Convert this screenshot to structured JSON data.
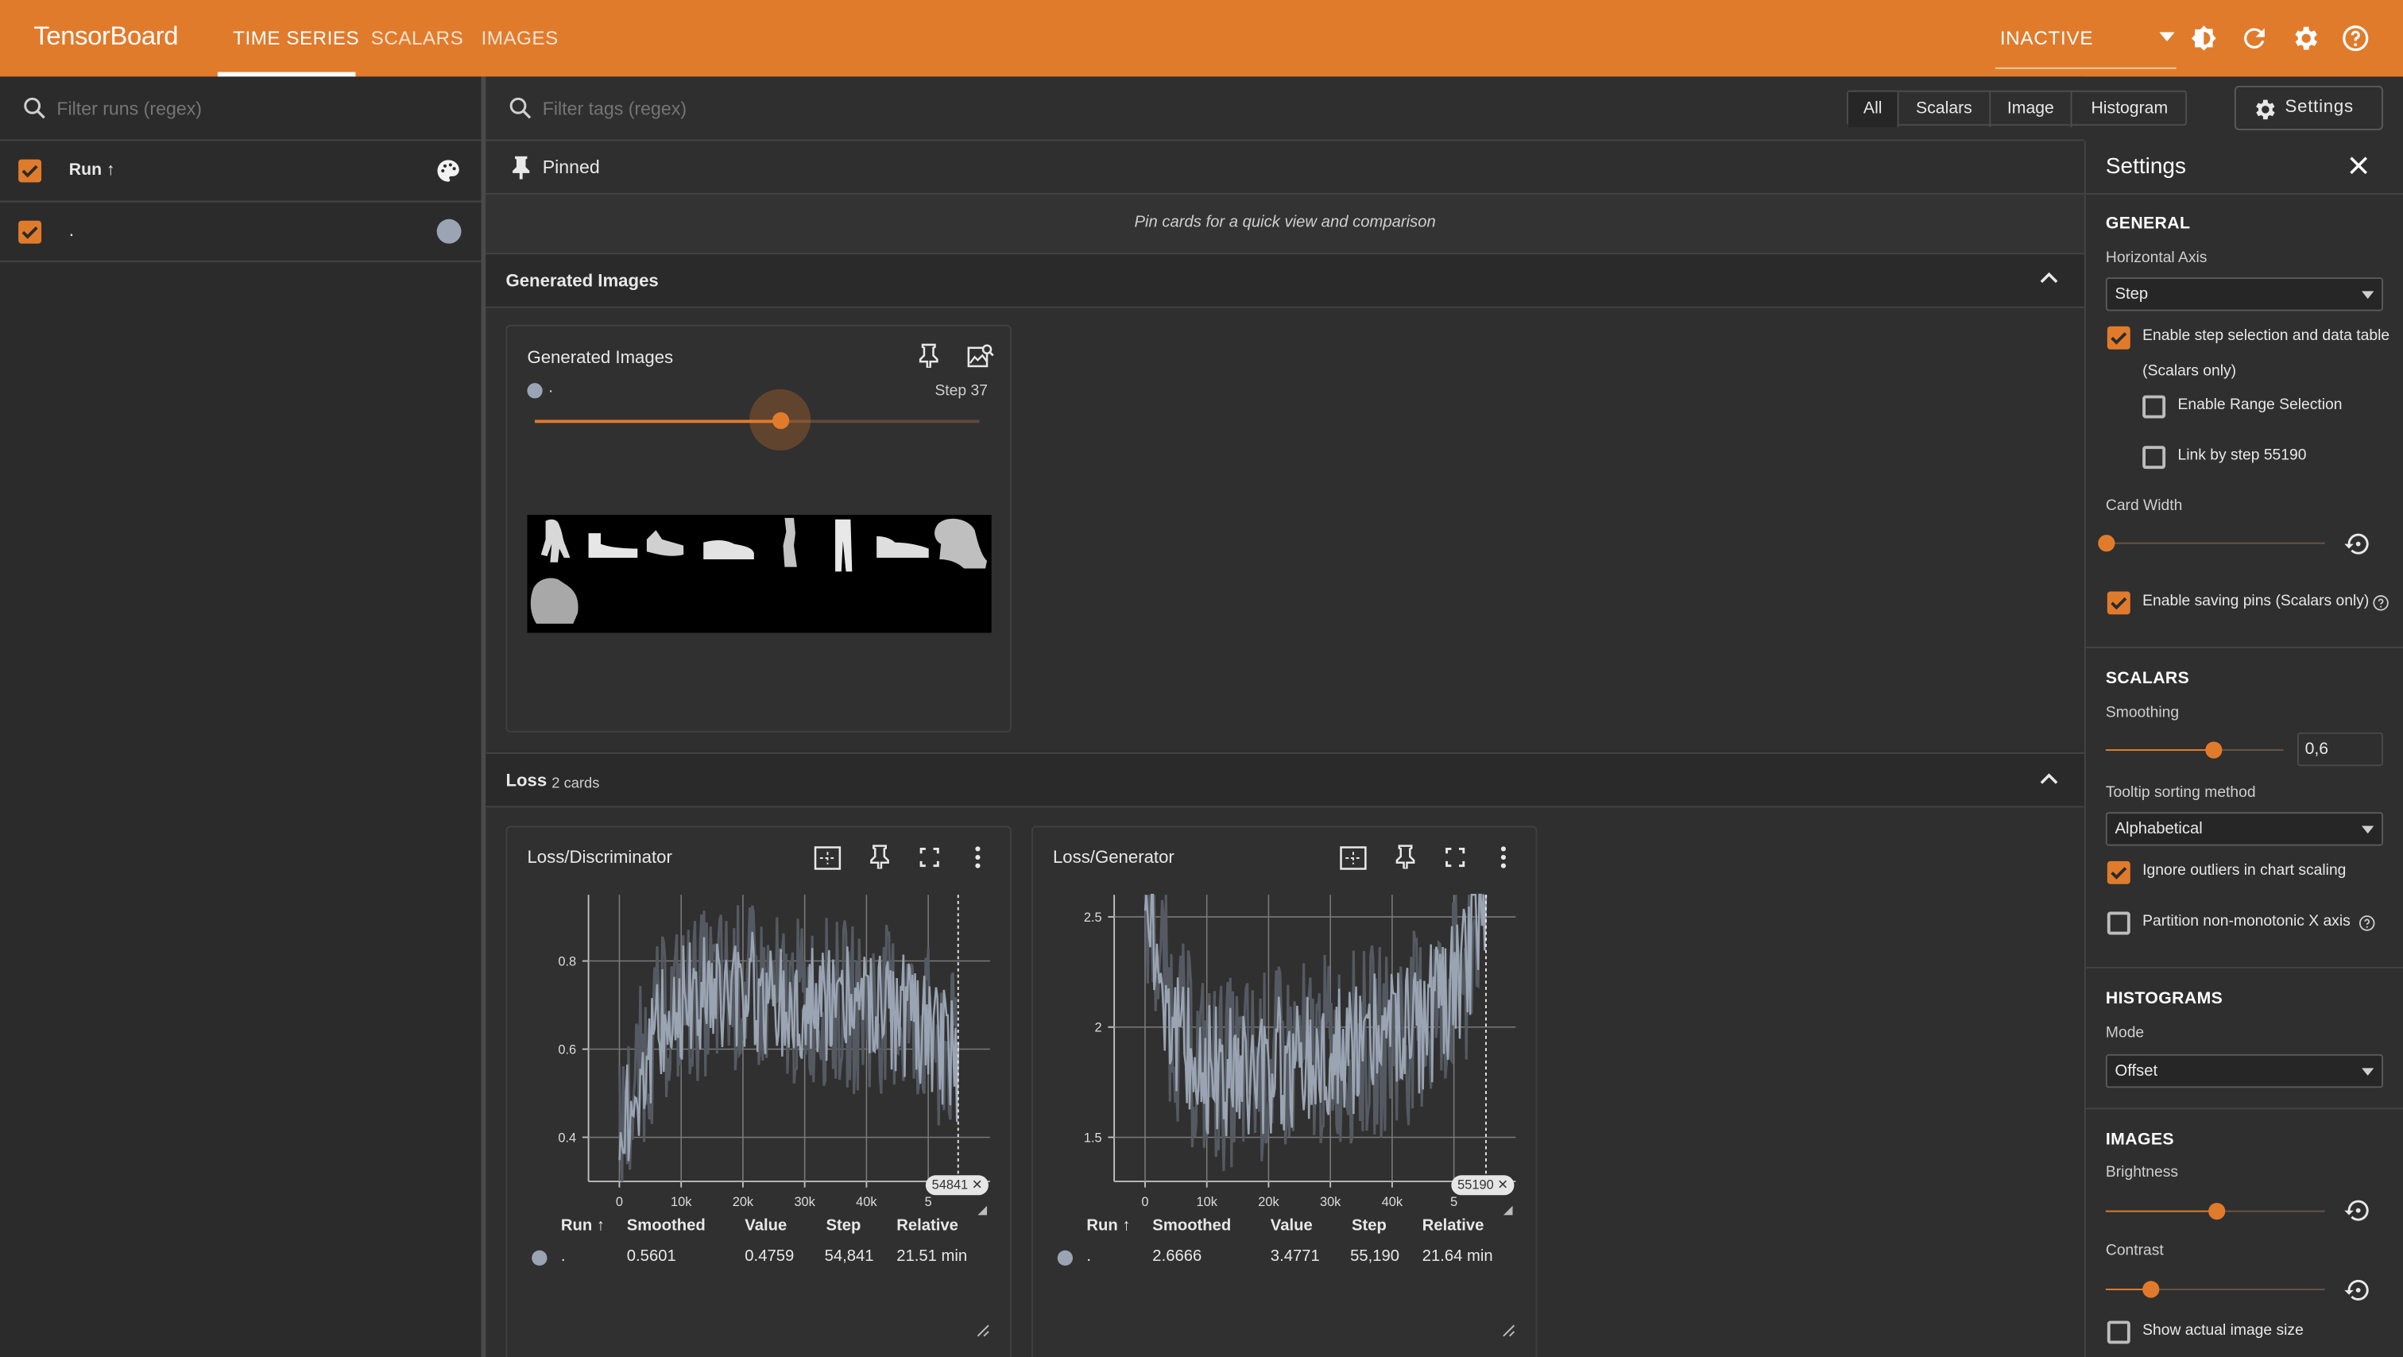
{
  "app": {
    "title": "TensorBoard"
  },
  "nav": {
    "tabs": [
      {
        "label": "TIME SERIES"
      },
      {
        "label": "SCALARS"
      },
      {
        "label": "IMAGES"
      }
    ],
    "status": "INACTIVE"
  },
  "runs": {
    "placeholder": "Filter runs (regex)",
    "header_label": "Run ↑",
    "rows": [
      {
        "name": "."
      }
    ]
  },
  "tags": {
    "placeholder": "Filter tags (regex)",
    "filters": [
      "All",
      "Scalars",
      "Image",
      "Histogram"
    ],
    "settings_button": "Settings"
  },
  "pinned": {
    "title": "Pinned",
    "empty_message": "Pin cards for a quick view and comparison"
  },
  "images_section": {
    "title": "Generated Images",
    "card": {
      "title": "Generated Images",
      "run": ".",
      "step_label": "Step 37",
      "slider_fraction": 0.55
    }
  },
  "loss_section": {
    "title": "Loss",
    "count": "2 cards"
  },
  "cards": [
    {
      "title": "Loss/Discriminator",
      "step_badge": "54841",
      "columns": [
        "Run ↑",
        "Smoothed",
        "Value",
        "Step",
        "Relative"
      ],
      "row": {
        "run": ".",
        "smoothed": "0.5601",
        "value": "0.4759",
        "step": "54,841",
        "relative": "21.51 min"
      }
    },
    {
      "title": "Loss/Generator",
      "step_badge": "55190",
      "columns": [
        "Run ↑",
        "Smoothed",
        "Value",
        "Step",
        "Relative"
      ],
      "row": {
        "run": ".",
        "smoothed": "2.6666",
        "value": "3.4771",
        "step": "55,190",
        "relative": "21.64 min"
      }
    }
  ],
  "chart_data": [
    {
      "type": "line",
      "title": "Loss/Discriminator",
      "xlabel": "",
      "ylabel": "",
      "x_ticks": [
        "0",
        "10k",
        "20k",
        "30k",
        "40k",
        "5"
      ],
      "y_ticks": [
        "0.4",
        "0.6",
        "0.8"
      ],
      "xlim": [
        -5000,
        60000
      ],
      "ylim": [
        0.3,
        0.95
      ],
      "grid": true,
      "series": [
        {
          "x": [
            0,
            2000,
            4000,
            6000,
            8000,
            10000,
            13000,
            16000,
            20000,
            24000,
            28000,
            32000,
            36000,
            40000,
            44000,
            48000,
            52000,
            54841
          ],
          "values": [
            0.38,
            0.48,
            0.58,
            0.64,
            0.68,
            0.7,
            0.72,
            0.73,
            0.74,
            0.72,
            0.7,
            0.71,
            0.7,
            0.68,
            0.69,
            0.66,
            0.62,
            0.5601
          ],
          "spread": 0.14
        }
      ]
    },
    {
      "type": "line",
      "title": "Loss/Generator",
      "xlabel": "",
      "ylabel": "",
      "x_ticks": [
        "0",
        "10k",
        "20k",
        "30k",
        "40k",
        "5"
      ],
      "y_ticks": [
        "1.5",
        "2",
        "2.5"
      ],
      "xlim": [
        -5000,
        60000
      ],
      "ylim": [
        1.3,
        2.6
      ],
      "grid": true,
      "series": [
        {
          "x": [
            0,
            2000,
            4000,
            6000,
            8000,
            10000,
            13000,
            16000,
            20000,
            24000,
            28000,
            32000,
            36000,
            40000,
            44000,
            48000,
            52000,
            55190
          ],
          "values": [
            2.6,
            2.35,
            2.1,
            1.95,
            1.85,
            1.8,
            1.78,
            1.8,
            1.82,
            1.85,
            1.88,
            1.9,
            1.92,
            1.95,
            2.0,
            2.1,
            2.3,
            2.6666
          ],
          "spread": 0.32
        }
      ]
    }
  ],
  "settings": {
    "title": "Settings",
    "general": {
      "heading": "GENERAL",
      "horizontal_axis_label": "Horizontal Axis",
      "horizontal_axis_value": "Step",
      "step_selection_label": "Enable step selection and data table",
      "step_selection_sub": "(Scalars only)",
      "range_selection_label": "Enable Range Selection",
      "link_step_label": "Link by step 55190",
      "card_width_label": "Card Width",
      "card_width_fraction": 0.0,
      "saving_pins_label": "Enable saving pins (Scalars only)"
    },
    "scalars": {
      "heading": "SCALARS",
      "smoothing_label": "Smoothing",
      "smoothing_value": "0,6",
      "smoothing_fraction": 0.6,
      "tooltip_label": "Tooltip sorting method",
      "tooltip_value": "Alphabetical",
      "ignore_outliers_label": "Ignore outliers in chart scaling",
      "partition_label": "Partition non-monotonic X axis"
    },
    "histograms": {
      "heading": "HISTOGRAMS",
      "mode_label": "Mode",
      "mode_value": "Offset"
    },
    "images": {
      "heading": "IMAGES",
      "brightness_label": "Brightness",
      "brightness_fraction": 0.5,
      "contrast_label": "Contrast",
      "contrast_fraction": 0.2,
      "actual_size_label": "Show actual image size"
    }
  },
  "colors": {
    "accent": "#e17b2c",
    "series": "#9aa4b2",
    "series_raw": "#555a62"
  }
}
